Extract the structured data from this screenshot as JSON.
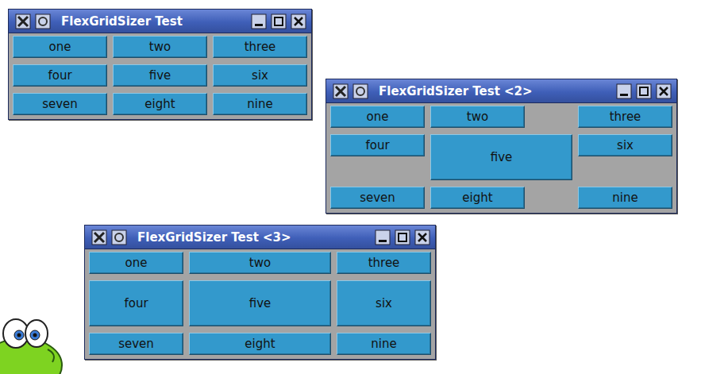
{
  "windows": [
    {
      "title": "FlexGridSizer Test",
      "kind": "plain",
      "buttons": [
        {
          "label": "one",
          "expand": true
        },
        {
          "label": "two",
          "expand": true
        },
        {
          "label": "three",
          "expand": true
        },
        {
          "label": "four",
          "expand": true
        },
        {
          "label": "five",
          "expand": true
        },
        {
          "label": "six",
          "expand": true
        },
        {
          "label": "seven",
          "expand": true
        },
        {
          "label": "eight",
          "expand": true
        },
        {
          "label": "nine",
          "expand": true
        }
      ]
    },
    {
      "title": "FlexGridSizer Test <2>",
      "kind": "growable",
      "buttons": [
        {
          "label": "one",
          "expand": false
        },
        {
          "label": "two",
          "expand": false
        },
        {
          "label": "three",
          "expand": false
        },
        {
          "label": "four",
          "expand": false
        },
        {
          "label": "five",
          "expand": true
        },
        {
          "label": "six",
          "expand": false
        },
        {
          "label": "seven",
          "expand": false
        },
        {
          "label": "eight",
          "expand": false
        },
        {
          "label": "nine",
          "expand": false
        }
      ]
    },
    {
      "title": "FlexGridSizer Test <3>",
      "kind": "growable",
      "buttons": [
        {
          "label": "one",
          "expand": true
        },
        {
          "label": "two",
          "expand": true
        },
        {
          "label": "three",
          "expand": true
        },
        {
          "label": "four",
          "expand": true
        },
        {
          "label": "five",
          "expand": true
        },
        {
          "label": "six",
          "expand": true
        },
        {
          "label": "seven",
          "expand": true
        },
        {
          "label": "eight",
          "expand": true
        },
        {
          "label": "nine",
          "expand": true
        }
      ]
    }
  ]
}
